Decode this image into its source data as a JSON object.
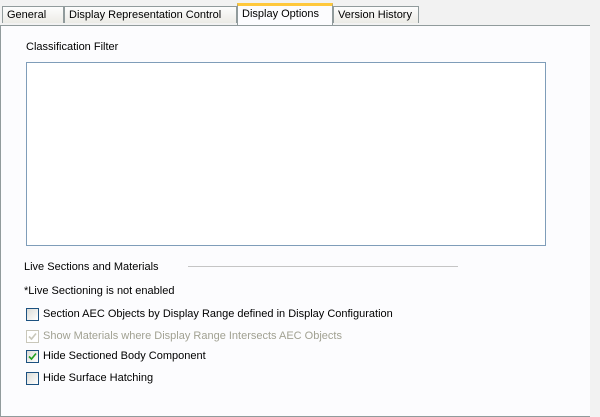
{
  "tabs": [
    {
      "label": "General"
    },
    {
      "label": "Display Representation Control"
    },
    {
      "label": "Display Options",
      "active": true
    },
    {
      "label": "Version History"
    }
  ],
  "classification_filter": {
    "label": "Classification Filter"
  },
  "live_sections": {
    "group_label": "Live Sections and Materials",
    "status_text": "*Live Sectioning is not enabled"
  },
  "options": [
    {
      "label": "Section AEC Objects by Display Range defined in Display Configuration",
      "checked": false,
      "enabled": true
    },
    {
      "label": "Show Materials where Display Range Intersects AEC Objects",
      "checked": true,
      "enabled": false
    },
    {
      "label": "Hide Sectioned Body Component",
      "checked": true,
      "enabled": true
    },
    {
      "label": "Hide Surface Hatching",
      "checked": false,
      "enabled": true
    }
  ],
  "colors": {
    "accent_tab": "#ffc83c",
    "check_enabled": "#21a121",
    "check_disabled": "#c9c7ba"
  }
}
